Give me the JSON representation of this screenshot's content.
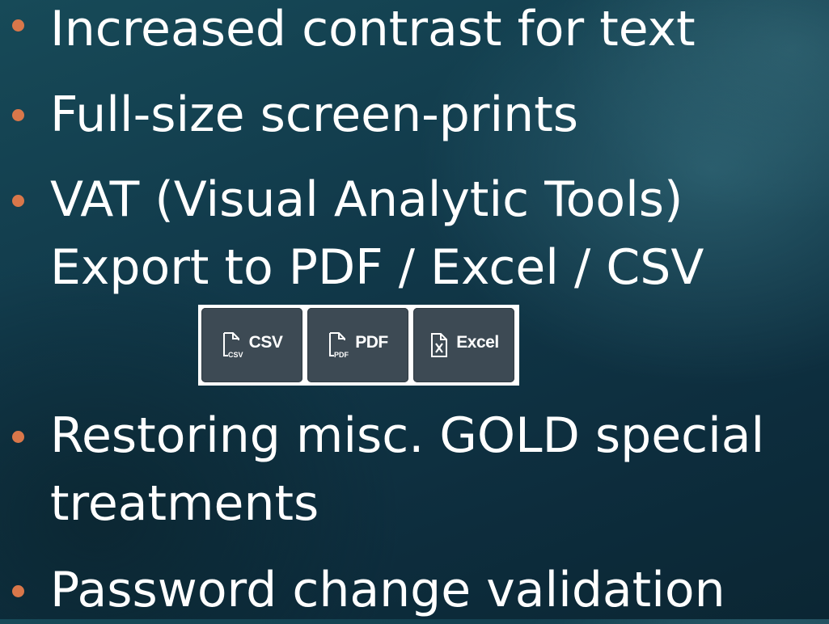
{
  "bullets": [
    {
      "lines": [
        "Increased contrast for text"
      ]
    },
    {
      "lines": [
        "Full-size screen-prints"
      ]
    },
    {
      "lines": [
        "VAT (Visual Analytic Tools)",
        "Export to PDF / Excel / CSV"
      ]
    },
    {
      "lines": [
        "Restoring misc. GOLD special",
        "treatments"
      ]
    },
    {
      "lines": [
        "Password change validation"
      ]
    }
  ],
  "export_buttons": [
    {
      "label": "CSV",
      "icon": "csv-file-icon",
      "icon_sub": "CSV"
    },
    {
      "label": "PDF",
      "icon": "pdf-file-icon",
      "icon_sub": "PDF"
    },
    {
      "label": "Excel",
      "icon": "excel-file-icon"
    }
  ],
  "colors": {
    "bullet": "#d9774a",
    "text": "#ffffff",
    "button_bg": "#3d4a54",
    "background": "#11394a"
  }
}
